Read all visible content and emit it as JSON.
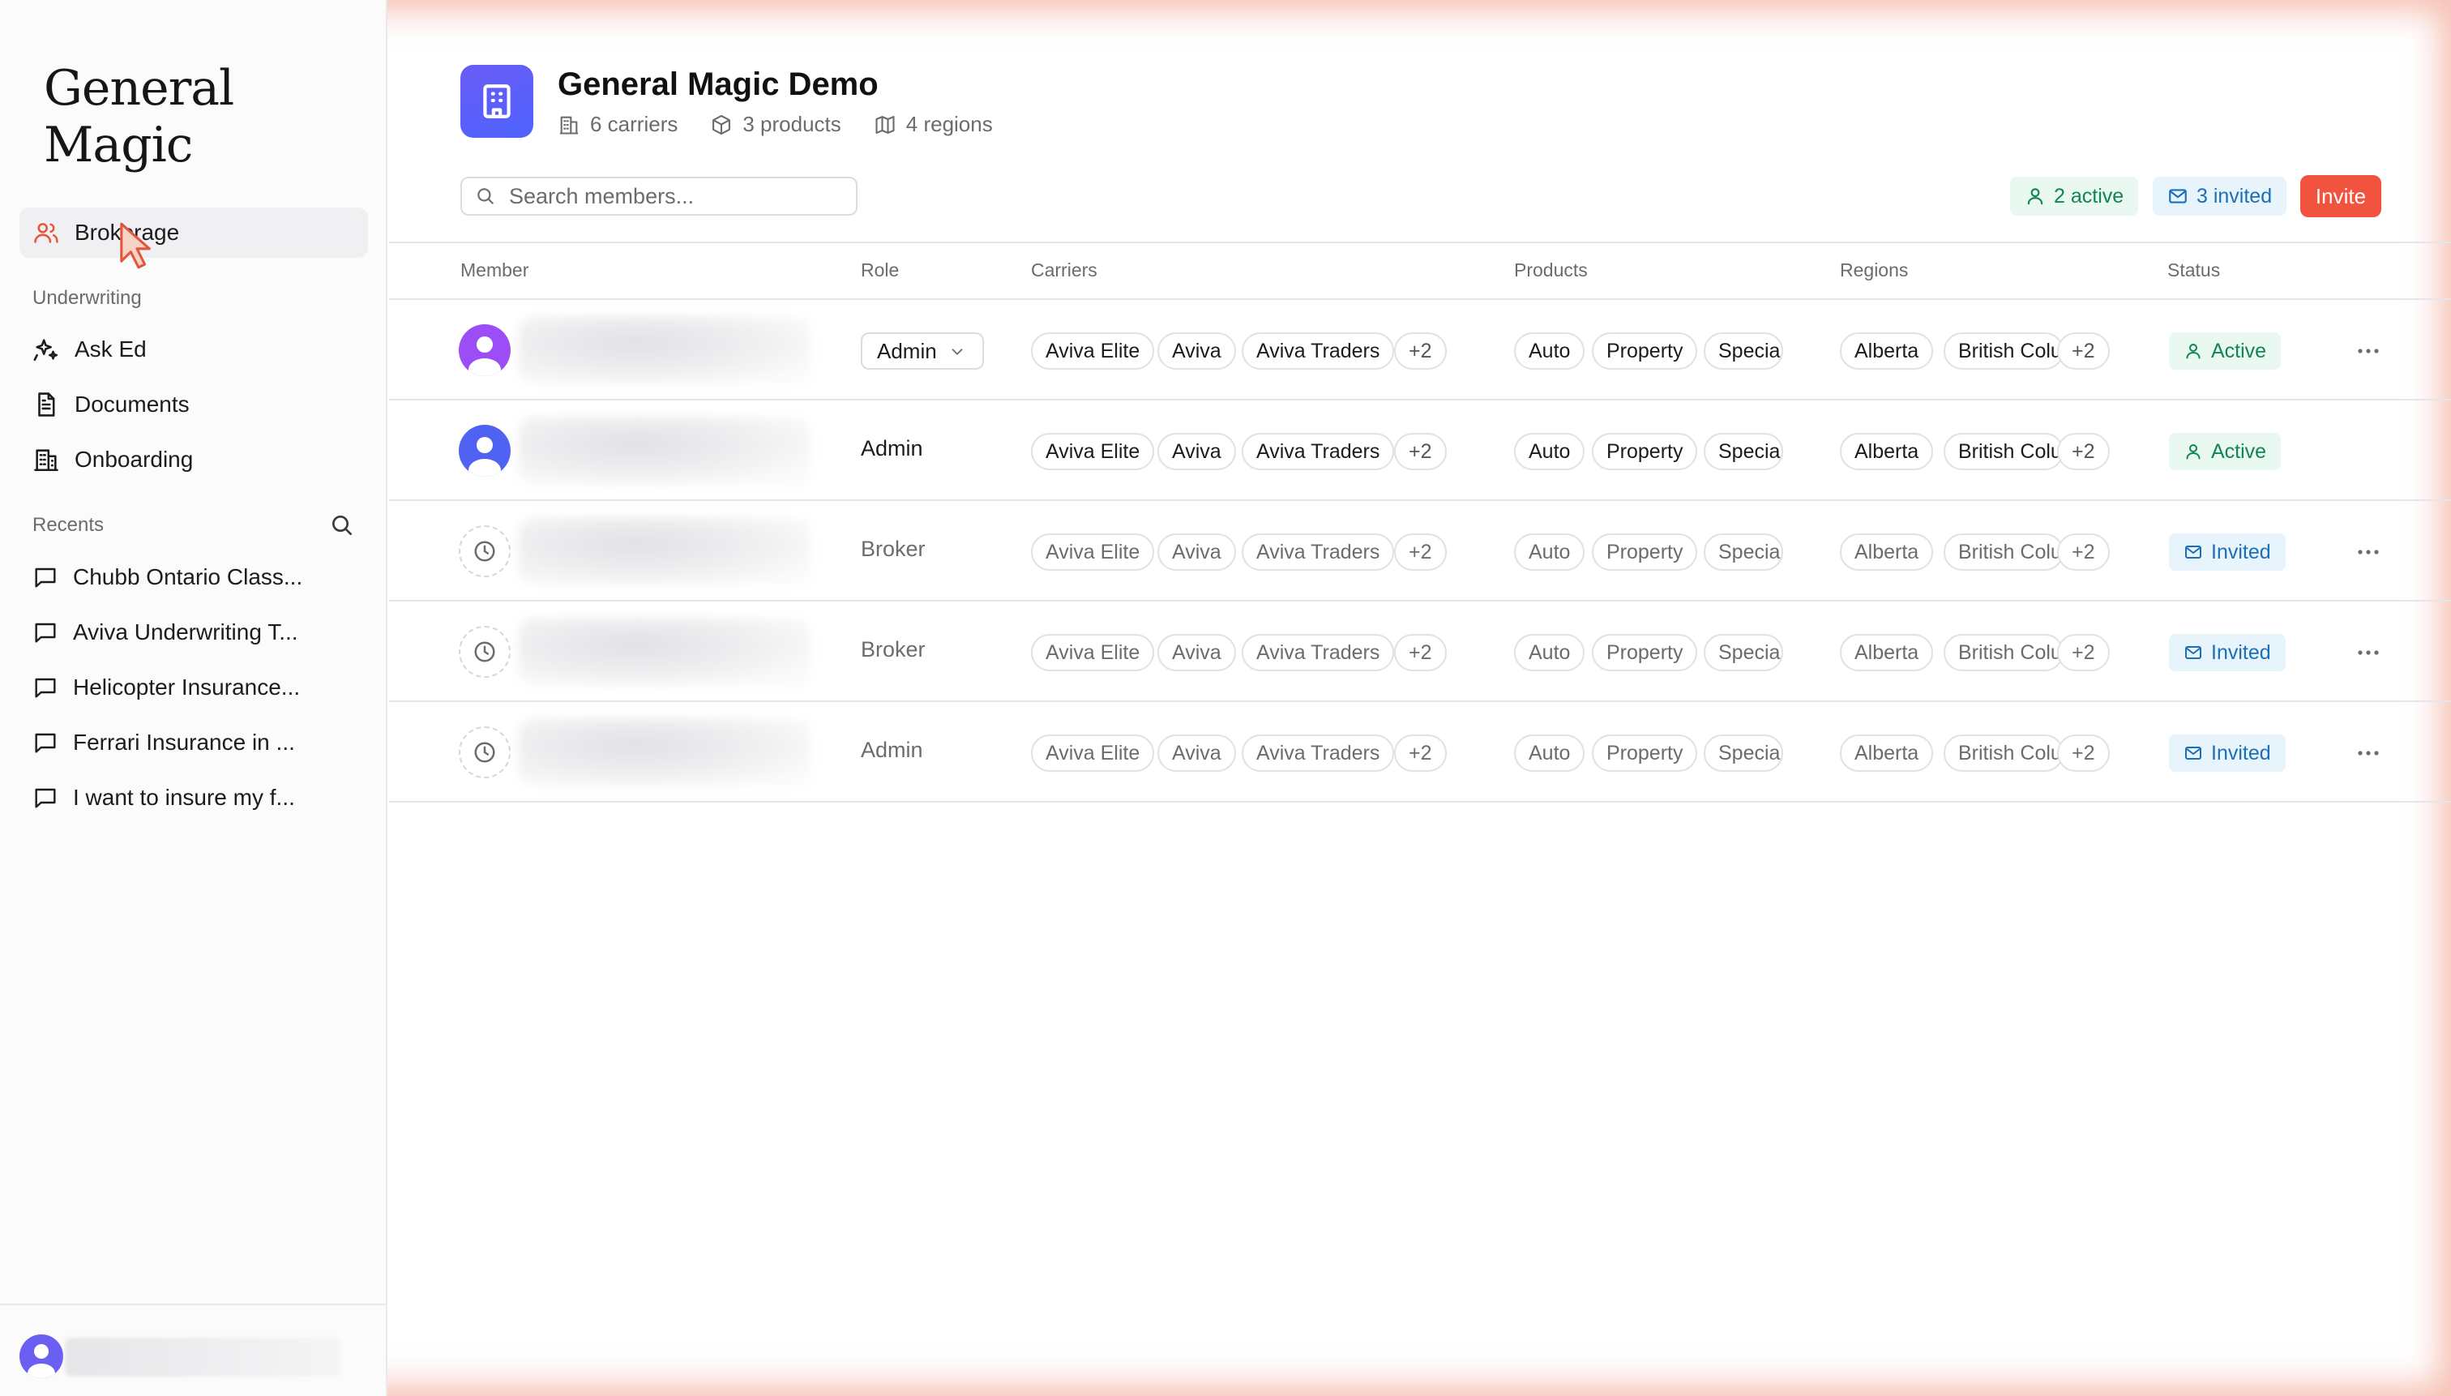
{
  "app": {
    "logo_text": "General Magic"
  },
  "sidebar": {
    "nav": [
      {
        "label": "Brokerage",
        "icon": "users-icon",
        "active": true
      },
      {
        "label": "Ask Ed",
        "icon": "sparkles-icon"
      },
      {
        "label": "Documents",
        "icon": "document-icon"
      },
      {
        "label": "Onboarding",
        "icon": "building-icon"
      }
    ],
    "underwriting_label": "Underwriting",
    "recents_label": "Recents",
    "recents": [
      "Chubb Ontario Class...",
      "Aviva Underwriting T...",
      "Helicopter Insurance...",
      "Ferrari Insurance in ...",
      "I want to insure my f..."
    ]
  },
  "org": {
    "name": "General Magic Demo",
    "carriers": "6 carriers",
    "products": "3 products",
    "regions": "4 regions"
  },
  "toolbar": {
    "search_placeholder": "Search members...",
    "active_count": "2 active",
    "invited_count": "3 invited",
    "invite_label": "Invite"
  },
  "table": {
    "headers": {
      "member": "Member",
      "role": "Role",
      "carriers": "Carriers",
      "products": "Products",
      "regions": "Regions",
      "status": "Status"
    },
    "rows": [
      {
        "role": "Admin",
        "role_editable": true,
        "carriers": [
          "Aviva Elite",
          "Aviva",
          "Aviva Traders"
        ],
        "carriers_more": "+2",
        "products": [
          "Auto",
          "Property",
          "Specia"
        ],
        "regions": [
          "Alberta",
          "British Colu"
        ],
        "regions_more": "+2",
        "status": "Active"
      },
      {
        "role": "Admin",
        "role_editable": false,
        "carriers": [
          "Aviva Elite",
          "Aviva",
          "Aviva Traders"
        ],
        "carriers_more": "+2",
        "products": [
          "Auto",
          "Property",
          "Specia"
        ],
        "regions": [
          "Alberta",
          "British Colu"
        ],
        "regions_more": "+2",
        "status": "Active"
      },
      {
        "role": "Broker",
        "role_editable": false,
        "carriers": [
          "Aviva Elite",
          "Aviva",
          "Aviva Traders"
        ],
        "carriers_more": "+2",
        "products": [
          "Auto",
          "Property",
          "Specia"
        ],
        "regions": [
          "Alberta",
          "British Colu"
        ],
        "regions_more": "+2",
        "status": "Invited"
      },
      {
        "role": "Broker",
        "role_editable": false,
        "carriers": [
          "Aviva Elite",
          "Aviva",
          "Aviva Traders"
        ],
        "carriers_more": "+2",
        "products": [
          "Auto",
          "Property",
          "Specia"
        ],
        "regions": [
          "Alberta",
          "British Colu"
        ],
        "regions_more": "+2",
        "status": "Invited"
      },
      {
        "role": "Admin",
        "role_editable": false,
        "carriers": [
          "Aviva Elite",
          "Aviva",
          "Aviva Traders"
        ],
        "carriers_more": "+2",
        "products": [
          "Auto",
          "Property",
          "Specia"
        ],
        "regions": [
          "Alberta",
          "British Colu"
        ],
        "regions_more": "+2",
        "status": "Invited"
      }
    ]
  },
  "colors": {
    "accent": "#f2533f",
    "active_text": "#11845b",
    "active_bg": "#e9f8f1",
    "invited_text": "#1c6fb6",
    "invited_bg": "#e8f4fc",
    "org_logo": "#5a60f8"
  }
}
